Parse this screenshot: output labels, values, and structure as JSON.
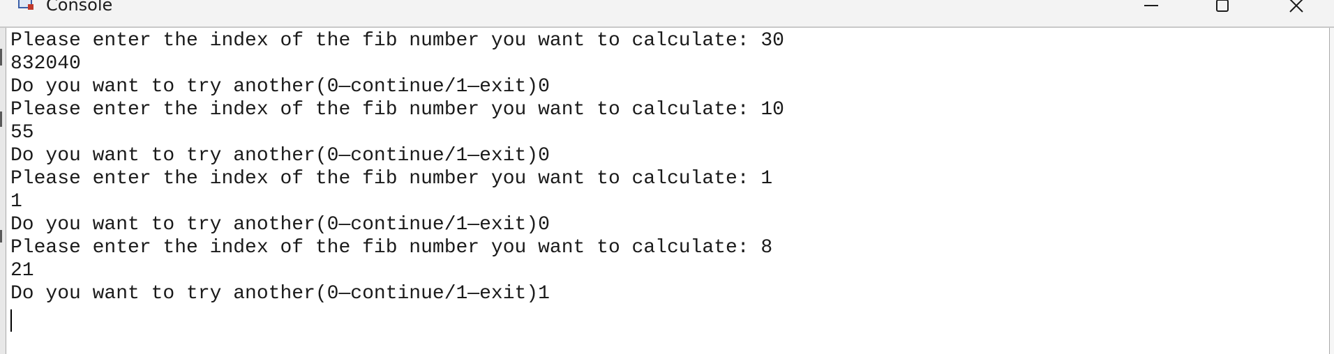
{
  "window": {
    "title": "Console",
    "controls": {
      "minimize_icon": "minimize-icon",
      "maximize_icon": "maximize-icon",
      "close_icon": "close-icon"
    }
  },
  "console": {
    "lines": [
      "Please enter the index of the fib number you want to calculate: 30",
      "832040",
      "Do you want to try another(0—continue/1—exit)0",
      "Please enter the index of the fib number you want to calculate: 10",
      "55",
      "Do you want to try another(0—continue/1—exit)0",
      "Please enter the index of the fib number you want to calculate: 1",
      "1",
      "Do you want to try another(0—continue/1—exit)0",
      "Please enter the index of the fib number you want to calculate: 8",
      "21",
      "Do you want to try another(0—continue/1—exit)1"
    ]
  },
  "colors": {
    "titlebar_bg": "#f3f3f3",
    "console_bg": "#ffffff",
    "text": "#1a1a1a"
  }
}
